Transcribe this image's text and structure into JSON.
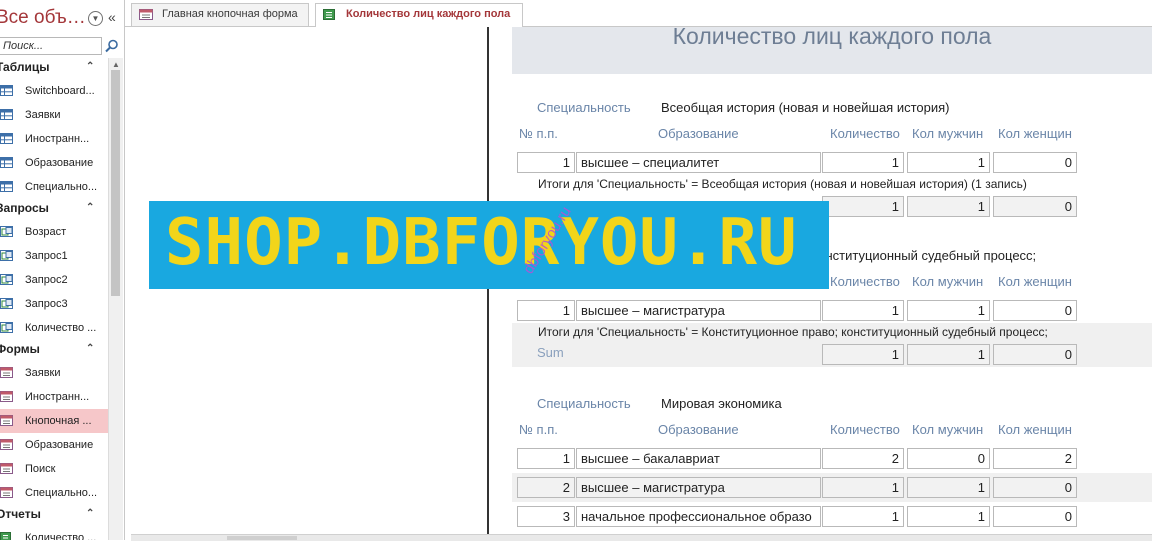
{
  "nav": {
    "title": "Все объ…",
    "search_placeholder": "Поиск...",
    "groups": [
      {
        "label": "Таблицы",
        "items": [
          "Switchboard...",
          "Заявки",
          "Иностранн...",
          "Образование",
          "Специально..."
        ]
      },
      {
        "label": "Запросы",
        "items": [
          "Возраст",
          "Запрос1",
          "Запрос2",
          "Запрос3",
          "Количество ..."
        ]
      },
      {
        "label": "Формы",
        "items": [
          "Заявки",
          "Иностранн...",
          "Кнопочная ...",
          "Образование",
          "Поиск",
          "Специально..."
        ]
      },
      {
        "label": "Отчеты",
        "items": [
          "Количество ..."
        ]
      }
    ]
  },
  "tabs": {
    "main_form": "Главная кнопочная форма",
    "report": "Количество лиц каждого пола"
  },
  "report": {
    "title": "Количество лиц каждого пола",
    "spec_label": "Специальность",
    "headers": {
      "num": "№ п.п.",
      "education": "Образование",
      "count": "Количество",
      "men": "Кол мужчин",
      "women": "Кол женщин"
    },
    "sum_label": "Sum",
    "sections": [
      {
        "specialty": "Всеобщая история (новая и новейшая история)",
        "rows": [
          {
            "n": "1",
            "edu": "высшее – специалитет",
            "count": "1",
            "men": "1",
            "women": "0"
          }
        ],
        "total_text": "Итоги для 'Специальность' =  Всеобщая история (новая и новейшая история) (1 запись)",
        "totals": {
          "count": "1",
          "men": "1",
          "women": "0"
        }
      },
      {
        "specialty": "Конституционное право; конституционный судебный процесс;",
        "rows": [
          {
            "n": "1",
            "edu": "высшее – магистратура",
            "count": "1",
            "men": "1",
            "women": "0"
          }
        ],
        "total_text": "Итоги для 'Специальность' =  Конституционное право; конституционный судебный процесс;",
        "totals": {
          "count": "1",
          "men": "1",
          "women": "0"
        }
      },
      {
        "specialty": "Мировая экономика",
        "rows": [
          {
            "n": "1",
            "edu": "высшее – бакалавриат",
            "count": "2",
            "men": "0",
            "women": "2"
          },
          {
            "n": "2",
            "edu": "высшее – магистратура",
            "count": "1",
            "men": "1",
            "women": "0"
          },
          {
            "n": "3",
            "edu": "начальное профессиональное образо",
            "count": "1",
            "men": "1",
            "women": "0"
          }
        ]
      }
    ]
  },
  "watermark": {
    "main": "SHOP.DBFORYOU.RU",
    "diagonal": "dbforyou.ru"
  },
  "colors": {
    "accent": "#a4373a",
    "selected_item": "#f6c7c9",
    "title_band": "#e4e7ec",
    "label_blue": "#6a85a8",
    "watermark_bg": "#19a8e0",
    "watermark_text": "#f2d51a"
  }
}
